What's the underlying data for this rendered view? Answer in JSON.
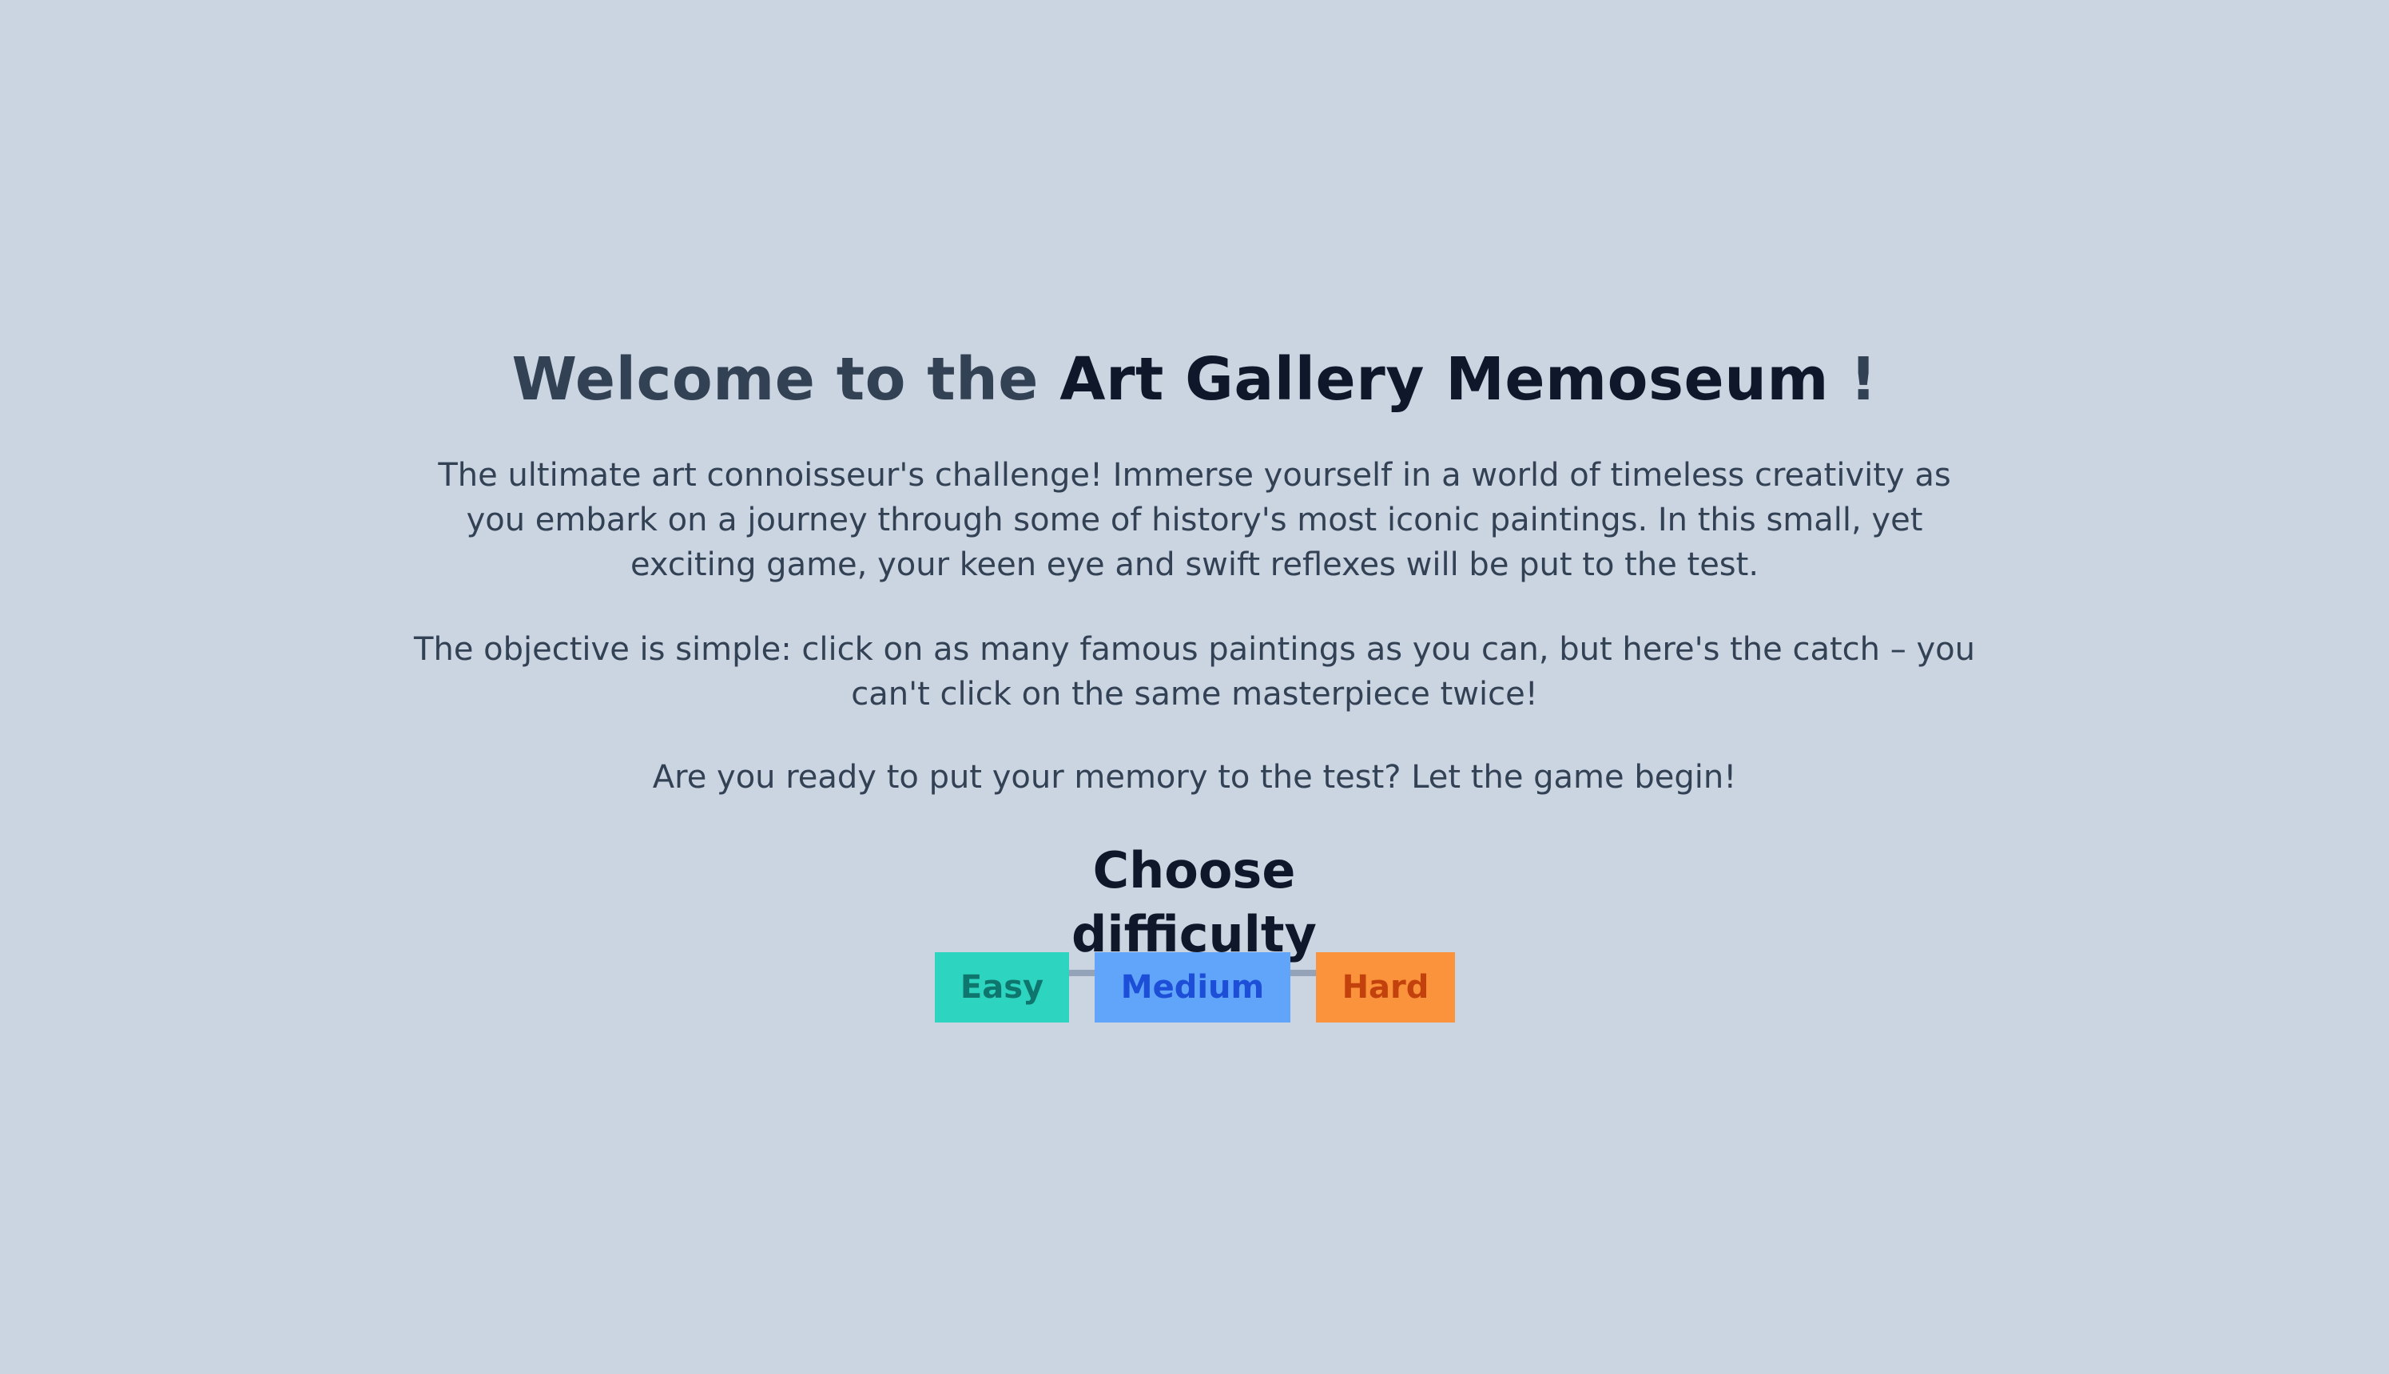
{
  "welcome": {
    "prefix": "Welcome to the ",
    "brand": "Art Gallery Memoseum",
    "suffix": " !"
  },
  "intro": {
    "paragraph1": "The ultimate art connoisseur's challenge! Immerse yourself in a world of timeless creativity as you embark on a journey through some of history's most iconic paintings. In this small, yet exciting game, your keen eye and swift reflexes will be put to the test.",
    "paragraph2": "The objective is simple: click on as many famous paintings as you can, but here's the catch – you can't click on the same masterpiece twice!",
    "paragraph3": "Are you ready to put your memory to the test? Let the game begin!"
  },
  "difficulty": {
    "heading": "Choose difficulty",
    "buttons": {
      "easy": "Easy",
      "medium": "Medium",
      "hard": "Hard"
    }
  },
  "colors": {
    "background": "#cbd5e1",
    "easy_bg": "#2dd4bf",
    "medium_bg": "#60a5fa",
    "hard_bg": "#fb923c"
  }
}
